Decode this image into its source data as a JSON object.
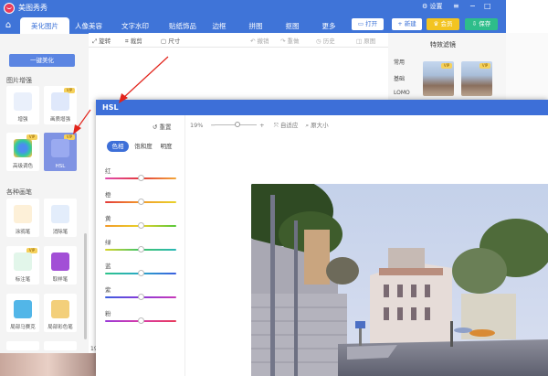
{
  "app": {
    "title": "美图秀秀",
    "settings": "设置"
  },
  "tabs": [
    "美化图片",
    "人像美容",
    "文字水印",
    "贴纸饰品",
    "边框",
    "拼图",
    "抠图",
    "更多"
  ],
  "top_buttons": {
    "open": "打开",
    "new": "新建",
    "vip": "会员",
    "save": "保存"
  },
  "toolbar": {
    "rotate": "旋转",
    "crop": "裁剪",
    "size": "尺寸",
    "undo": "撤销",
    "redo": "重做",
    "history": "历史",
    "compare": "原图"
  },
  "left_panel": {
    "one_click": "一键美化",
    "section_enhance": "图片增强",
    "enhance_items": [
      {
        "label": "增强",
        "vip": false
      },
      {
        "label": "画质增强",
        "vip": true
      },
      {
        "label": "高级调色",
        "vip": true
      },
      {
        "label": "HSL",
        "vip": false
      }
    ],
    "section_brush": "各种画笔",
    "brush_items": [
      {
        "label": "涂鸦笔",
        "vip": false
      },
      {
        "label": "消除笔",
        "vip": false
      },
      {
        "label": "标注笔",
        "vip": true
      },
      {
        "label": "取样笔",
        "vip": false
      },
      {
        "label": "局部马赛克",
        "vip": false
      },
      {
        "label": "局部彩色笔",
        "vip": false
      }
    ],
    "vip_badge": "VIP",
    "bottom_num": "19"
  },
  "filter_panel": {
    "title": "特效滤镜",
    "categories": [
      "常用",
      "基础",
      "LOMO"
    ]
  },
  "dialog": {
    "title": "HSL",
    "reset": "重置",
    "zoom": "19%",
    "zoom_minus": "−",
    "zoom_plus": "+",
    "fit": "自适应",
    "original_size": "原大小",
    "hsl_tabs": [
      "色相",
      "饱和度",
      "明度"
    ],
    "colors": [
      "红",
      "橙",
      "黄",
      "绿",
      "蓝",
      "紫",
      "粉"
    ]
  },
  "slider_values": [
    0.5,
    0.5,
    0.5,
    0.5,
    0.5,
    0.5,
    0.5
  ],
  "colors": {
    "brand": "#3f74d8",
    "accent_red": "#e2231a",
    "vip_gold": "#f3c421",
    "save_green": "#2ebd8a"
  }
}
